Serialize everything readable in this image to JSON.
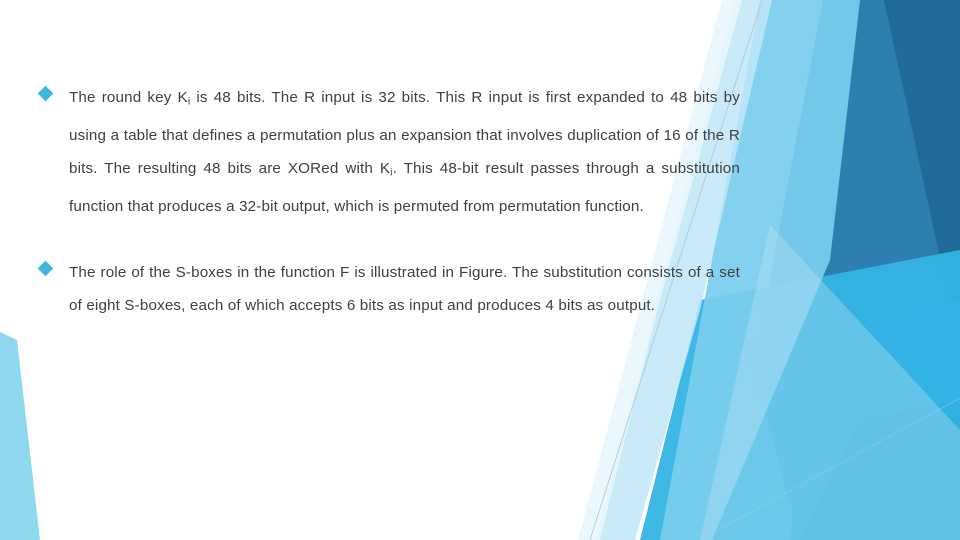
{
  "slide": {
    "background_color": "#ffffff",
    "text_color": "#404040",
    "accent_color": "#3EB6E0",
    "bullets": [
      {
        "marker": "diamond-bullet",
        "text_lead": "The round key K",
        "text_sub": "i",
        "text_rest": " is 48 bits. The R input is 32 bits. This R input is first expanded to 48 bits by using a table that defines a permutation plus an expansion that involves duplication of 16 of the R bits. The resulting 48 bits are XORed with K",
        "text_sub2": "i",
        "text_tail": ". This 48-bit result passes through a substitution function that produces a 32-bit output, which is permuted from permutation function."
      },
      {
        "marker": "diamond-bullet",
        "text": "The role of the S-boxes in the function F is illustrated in Figure. The substitution consists of a set of eight S-boxes, each of which accepts 6 bits as input and produces 4 bits as output."
      }
    ]
  },
  "decor": {
    "shapes": [
      {
        "name": "left-bottom-wedge",
        "color": "#8ED8F0"
      },
      {
        "name": "right-pale-band",
        "color": "#E8F6FC"
      },
      {
        "name": "right-light-band",
        "color": "#BFE6F7"
      },
      {
        "name": "right-sky-triangle",
        "color": "#79CDEE"
      },
      {
        "name": "right-cyan-triangle",
        "color": "#34B4E4"
      },
      {
        "name": "right-mid-blue-triangle",
        "color": "#2D9BD4"
      },
      {
        "name": "right-steel-triangle",
        "color": "#2D7FB0"
      },
      {
        "name": "right-deep-navy-triangle",
        "color": "#1F6A99"
      },
      {
        "name": "right-dark-edge",
        "color": "#2A79A8"
      },
      {
        "name": "hairline-diagonal",
        "color": "#A8C8D8"
      }
    ]
  }
}
